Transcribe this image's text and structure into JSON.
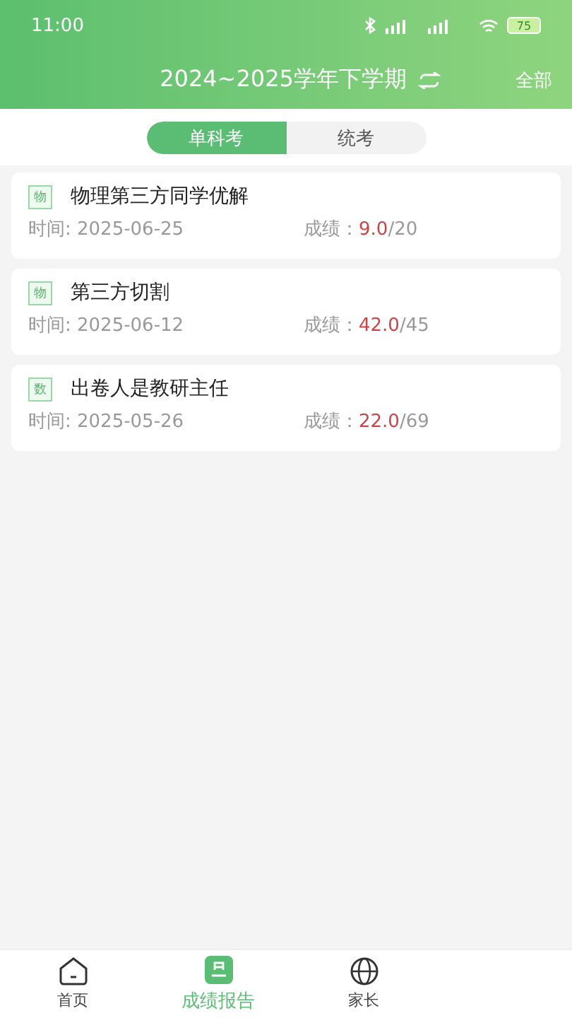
{
  "status_bar": {
    "time": "11:00",
    "battery": "75"
  },
  "header": {
    "title": "2024~2025学年下学期",
    "filter": "全部"
  },
  "segments": [
    {
      "label": "单科考",
      "selected": true
    },
    {
      "label": "统考",
      "selected": false
    }
  ],
  "exams": [
    {
      "subject": "物",
      "title": "物理第三方同学优解",
      "time": "时间: 2025-06-25",
      "score_label": "成绩：",
      "score": "9.0",
      "total": "/20"
    },
    {
      "subject": "物",
      "title": "第三方切割",
      "time": "时间: 2025-06-12",
      "score_label": "成绩：",
      "score": "42.0",
      "total": "/45"
    },
    {
      "subject": "数",
      "title": "出卷人是教研主任",
      "time": "时间: 2025-05-26",
      "score_label": "成绩：",
      "score": "22.0",
      "total": "/69"
    }
  ],
  "tab_bar": [
    {
      "label": "首页",
      "kind": "home",
      "selected": false
    },
    {
      "label": "成绩报告",
      "kind": "report",
      "selected": true
    },
    {
      "label": "家长",
      "kind": "globe",
      "selected": false
    }
  ]
}
